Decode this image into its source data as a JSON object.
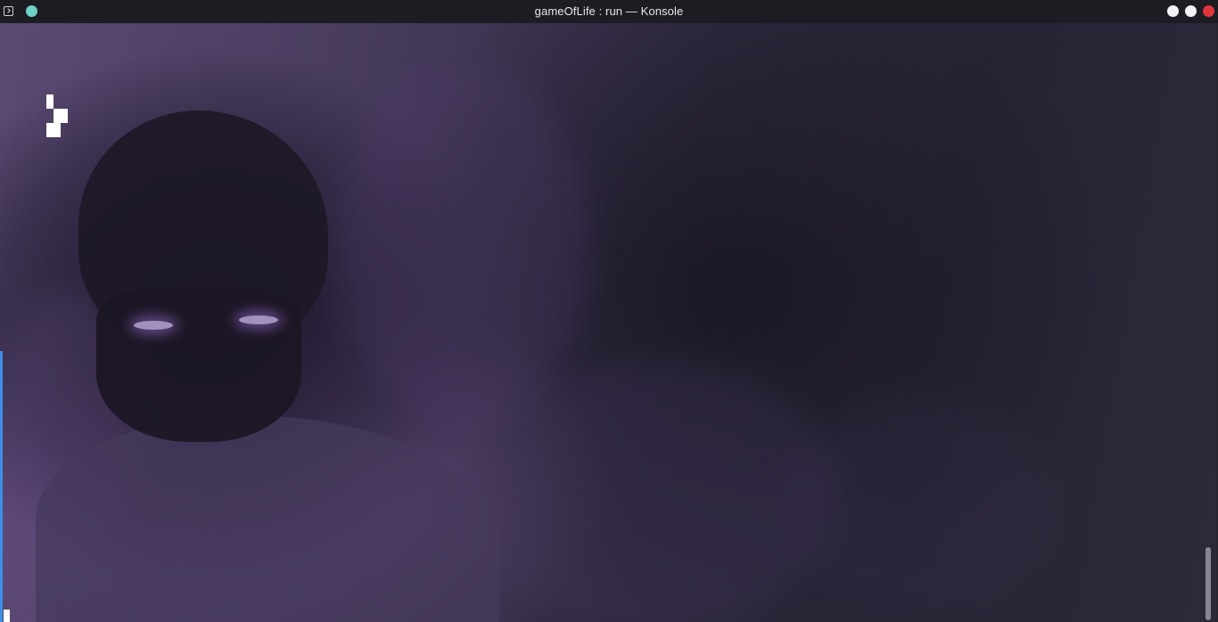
{
  "window": {
    "title": "gameOfLife : run — Konsole"
  },
  "titlebar": {
    "app_icon": "terminal-icon",
    "pin_icon": "pin-dot-icon",
    "buttons": [
      "minimize-icon",
      "maximize-icon",
      "close-icon"
    ]
  },
  "colors": {
    "close_button": "#e0353b",
    "pin_dot": "#6fd0c4",
    "scroll_indicator": "#3d8ee6"
  },
  "terminal": {
    "background": "anime character with purple shadow flames wallpaper",
    "live_cells": "glider pattern"
  }
}
